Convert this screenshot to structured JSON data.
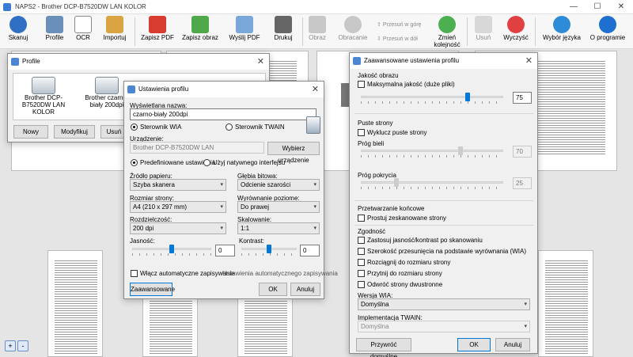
{
  "window": {
    "title": "NAPS2 - Brother DCP-B7520DW LAN KOLOR",
    "min": "—",
    "max": "☐",
    "close": "✕"
  },
  "toolbar": {
    "scan": "Skanuj",
    "profile": "Profile",
    "ocr": "OCR",
    "import": "Importuj",
    "save_pdf": "Zapisz PDF",
    "save_image": "Zapisz obraz",
    "send_pdf": "Wyślij PDF",
    "print": "Drukuj",
    "image": "Obraz",
    "rotate": "Obracanie",
    "move_up": "Przesuń w górę",
    "move_down": "Przesuń w dół",
    "reverse": "Zmień kolejność",
    "delete": "Usuń",
    "clear": "Wyczyść",
    "language": "Wybór języka",
    "about": "O programie"
  },
  "profiles": {
    "title": "Profile",
    "items": [
      {
        "label": "Brother DCP-B7520DW LAN KOLOR"
      },
      {
        "label": "Brother czarno-biały 200dpi"
      }
    ],
    "new": "Nowy",
    "edit": "Modyfikuj",
    "delete": "Usuń"
  },
  "profile_settings": {
    "title": "Ustawienia profilu",
    "display_name_label": "Wyświetlana nazwa:",
    "display_name_value": "czarno-biały 200dpi",
    "driver_wia": "Sterownik WIA",
    "driver_twain": "Sterownik TWAIN",
    "device_label": "Urządzenie:",
    "device_value": "Brother DCP-B7520DW LAN",
    "choose_device": "Wybierz urządzenie",
    "predefined": "Predefiniowane ustawienia",
    "native": "Użyj natywnego interfejsu",
    "paper_source_label": "Źródło papieru:",
    "paper_source": "Szyba skanera",
    "bit_depth_label": "Głębia bitowa:",
    "bit_depth": "Odcienie szarości",
    "page_size_label": "Rozmiar strony:",
    "page_size": "A4 (210 x 297 mm)",
    "h_align_label": "Wyrównanie poziome:",
    "h_align": "Do prawej",
    "resolution_label": "Rozdzielczość:",
    "resolution": "200 dpi",
    "scale_label": "Skalowanie:",
    "scale": "1:1",
    "brightness_label": "Jasność:",
    "brightness": "0",
    "brightness_level": 0.5,
    "contrast_label": "Kontrast:",
    "contrast": "0",
    "contrast_level": 0.5,
    "auto_save": "Włącz automatyczne zapisywanie",
    "auto_save_settings": "Ustawienia automatycznego zapisywania",
    "advanced": "Zaawansowane",
    "ok": "OK",
    "cancel": "Anuluj"
  },
  "advanced_settings": {
    "title": "Zaawansowane ustawienia profilu",
    "image_quality": "Jakość obrazu",
    "max_quality": "Maksymalna jakość (duże pliki)",
    "quality_value": "75",
    "quality_level": 0.75,
    "blank_pages": "Puste strony",
    "exclude_blank": "Wyklucz puste strony",
    "white_threshold_label": "Próg bieli",
    "white_threshold": "70",
    "white_level": 0.7,
    "coverage_threshold_label": "Próg pokrycia",
    "coverage_threshold": "25",
    "coverage_level": 0.25,
    "post_processing": "Przetwarzanie końcowe",
    "deskew": "Prostuj zeskanowane strony",
    "compatibility": "Zgodność",
    "apply_brightness": "Zastosuj jasność/kontrast po skanowaniu",
    "width_offset": "Szerokość przesunięcia na podstawie wyrównania (WIA)",
    "stretch": "Rozciągnij do rozmiaru strony",
    "crop": "Przytnij do rozmiaru strony",
    "flip_duplex": "Odwróć strony dwustronne",
    "wia_version_label": "Wersja WIA:",
    "wia_version": "Domyślna",
    "twain_impl_label": "Implementacja TWAIN:",
    "twain_impl": "Domyślna",
    "restore": "Przywróć domyślne",
    "ok": "OK",
    "cancel": "Anuluj"
  },
  "zoom": {
    "zoom_in": "+",
    "zoom_out": "-"
  }
}
